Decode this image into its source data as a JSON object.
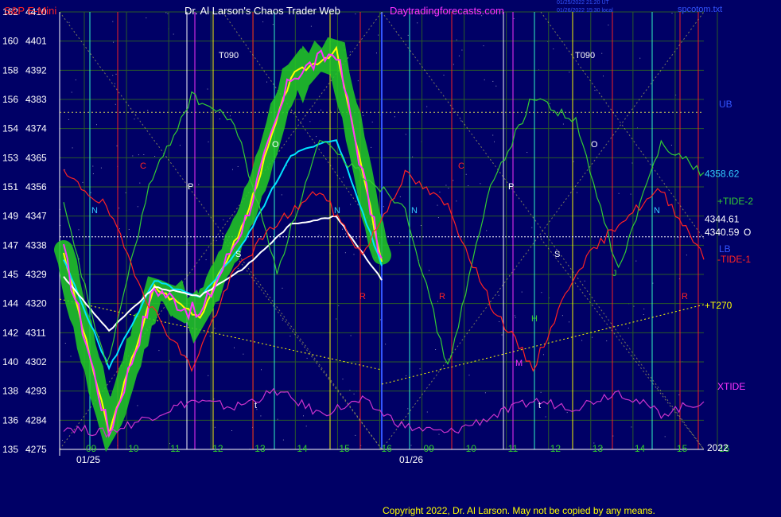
{
  "header": {
    "symbol": "S&P E-Mini",
    "title": "Dr. Al Larson's Chaos Trader Web",
    "site": "Daytradingforecasts.com",
    "stamp1": "01/25/2022 21:20 UT",
    "stamp2": "01/26/2022 15:30 local",
    "file": "spcotom.txt"
  },
  "footer": {
    "copyright": "Copyright 2022, Dr. Al Larson. May not be copied by any means."
  },
  "colors": {
    "background": "#000066",
    "price_bar": "#ff33ff",
    "green_halo": "#22cc22",
    "fast_avg": "#ffff00",
    "mid_avg": "#00e5ff",
    "slow_avg": "#ffffff",
    "tide1": "#ff2222",
    "tide2": "#33cc33",
    "xtide": "#cc33cc",
    "band": "#2244ff"
  },
  "chart_data": {
    "type": "line",
    "title": "S&P E-Mini",
    "y_left_ticks": [
      "162",
      "160",
      "158",
      "156",
      "154",
      "153",
      "151",
      "149",
      "147",
      "145",
      "144",
      "142",
      "140",
      "138",
      "136",
      "135"
    ],
    "y_right_ticks": [
      "4410",
      "4401",
      "4392",
      "4383",
      "4374",
      "4365",
      "4356",
      "4347",
      "4338",
      "4329",
      "4320",
      "4311",
      "4302",
      "4293",
      "4284",
      "4275"
    ],
    "ylim": [
      4275,
      4410
    ],
    "x_hour_labels": [
      "09",
      "10",
      "11",
      "12",
      "13",
      "14",
      "15",
      "16",
      "09",
      "10",
      "11",
      "12",
      "13",
      "14",
      "15",
      "16"
    ],
    "dates": [
      "01/25",
      "01/26"
    ],
    "year_label": "2022",
    "x": [
      "01/25 09",
      "01/25 10",
      "01/25 11",
      "01/25 12",
      "01/25 13",
      "01/25 14",
      "01/25 15",
      "01/25 16"
    ],
    "series": [
      {
        "name": "price",
        "values": [
          4336,
          4280,
          4325,
          4316,
          4346,
          4390,
          4398,
          4333
        ]
      },
      {
        "name": "+TIDE-2",
        "values": [
          4350,
          4300,
          4356,
          4384,
          4376,
          4330,
          4370,
          4360
        ]
      },
      {
        "name": "-TIDE-1",
        "values": [
          4360,
          4350,
          4320,
          4300,
          4330,
          4345,
          4355,
          4335
        ]
      },
      {
        "name": "XTIDE",
        "values": [
          4282,
          4280,
          4285,
          4290,
          4288,
          4293,
          4286,
          4290
        ]
      }
    ],
    "levels": [
      {
        "label": "4358.62",
        "value": 4358.62
      },
      {
        "label": "4344.61",
        "value": 4344.61
      },
      {
        "label": "4340.59",
        "value": 4340.59
      }
    ],
    "right_labels": [
      "UB",
      "+TIDE-2",
      "LB",
      "-TIDE-1",
      "+T270",
      "XTIDE"
    ],
    "right_open_marker": "O",
    "letters": [
      {
        "text": "T090",
        "day": 0
      },
      {
        "text": "T090",
        "day": 1
      },
      {
        "text": "N"
      },
      {
        "text": "C"
      },
      {
        "text": "P"
      },
      {
        "text": "S"
      },
      {
        "text": "O"
      },
      {
        "text": "N"
      },
      {
        "text": "R"
      },
      {
        "text": "R"
      },
      {
        "text": "N"
      },
      {
        "text": "C"
      },
      {
        "text": "P"
      },
      {
        "text": "S"
      },
      {
        "text": "O"
      },
      {
        "text": "N"
      },
      {
        "text": "R"
      },
      {
        "text": "H"
      },
      {
        "text": "M"
      },
      {
        "text": "J"
      },
      {
        "text": "t"
      },
      {
        "text": "t"
      }
    ]
  }
}
